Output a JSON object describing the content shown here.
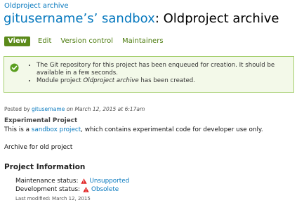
{
  "breadcrumb": "Oldproject archive",
  "title": {
    "sandbox_link": "gitusername’s’ sandbox",
    "separator_and_name": ": Oldproject archive"
  },
  "tabs": [
    {
      "label": "View",
      "active": true
    },
    {
      "label": "Edit"
    },
    {
      "label": "Version control"
    },
    {
      "label": "Maintainers"
    }
  ],
  "message": {
    "items": [
      {
        "text": "The Git repository for this project has been enqueued for creation. It should be available in a few seconds."
      },
      {
        "prefix": "Module project ",
        "emphasis": "Oldproject archive",
        "suffix": " has been created."
      }
    ]
  },
  "submitted": {
    "prefix": "Posted by ",
    "author": "gitusername",
    "middle": " on ",
    "date": "March 12, 2015 at 6:17am"
  },
  "experimental": {
    "heading": "Experimental Project",
    "prefix": "This is a ",
    "link": "sandbox project",
    "suffix": ", which contains experimental code for developer use only."
  },
  "description": "Archive for old project",
  "project_info": {
    "heading": "Project Information",
    "maintenance_label": "Maintenance status:",
    "maintenance_value": "Unsupported",
    "development_label": "Development status:",
    "development_value": "Obsolete",
    "last_modified": "Last modified: March 12, 2015"
  },
  "colors": {
    "link": "#0678be",
    "tab_active_bg": "#5b8a1a",
    "tab_text": "#4d7c0f",
    "message_bg": "#f3f9e9",
    "message_border": "#a5cf6e",
    "check": "#5a9e1f",
    "warning": "#e02020"
  },
  "icons": {
    "message": "check-circle-icon",
    "status": "warning-triangle-icon"
  }
}
